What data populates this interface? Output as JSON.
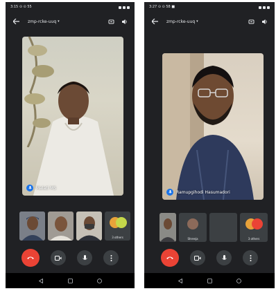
{
  "screens": [
    {
      "status_time": "3:15 ⊙ ⊙ 55",
      "meeting_code": "zmp-rcke-uuq",
      "main_participant_name": "Malati MS",
      "thumbnails": [
        {
          "caption": ""
        },
        {
          "caption": ""
        },
        {
          "caption": ""
        },
        {
          "caption": "3 others"
        }
      ]
    },
    {
      "status_time": "3:27 ⊙ ⊙ 58 ■",
      "meeting_code": "zmp-rcke-uuq",
      "main_participant_name": "Ramupgihodi Hasumadori",
      "thumbnails": [
        {
          "caption": ""
        },
        {
          "caption": "Shreeja"
        },
        {
          "caption": ""
        },
        {
          "caption": "3 others"
        }
      ]
    }
  ],
  "colors": {
    "background": "#202124",
    "end_call": "#ea4335",
    "mic_badge": "#1a73e8",
    "control_bg": "#3c4043"
  },
  "icons": {
    "back": "arrow-left-icon",
    "dropdown": "chevron-down-icon",
    "switch_camera": "switch-camera-icon",
    "speaker": "speaker-icon",
    "end_call": "phone-hangup-icon",
    "camera": "video-camera-icon",
    "mic": "microphone-icon",
    "more": "more-vertical-icon",
    "nav_back": "nav-back-icon",
    "nav_home": "nav-home-icon",
    "nav_recents": "nav-recents-icon"
  }
}
